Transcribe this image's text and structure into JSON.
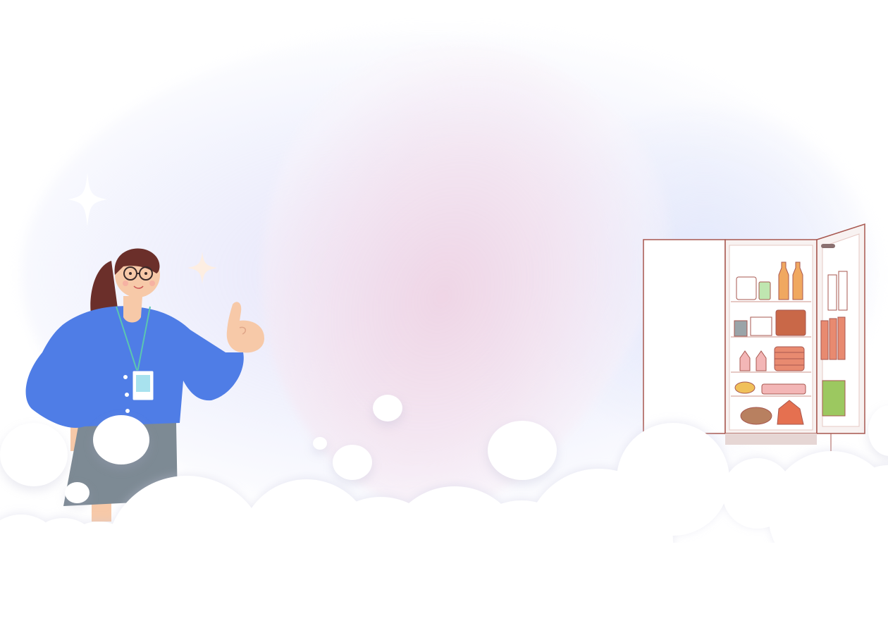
{
  "scene": {
    "illustration": "woman-thumbs-up-refrigerator",
    "background_color": "#ffffff",
    "colors": {
      "shirt": "#4f7de6",
      "skirt": "#7d8a94",
      "skin": "#f7c9a8",
      "hair": "#6b2f2a",
      "fridge_outline": "#a7574f",
      "lanyard": "#5bc6b0",
      "badge": "#a8e2ee"
    },
    "icons": [
      "sparkle-icon",
      "thumbs-up-icon",
      "id-badge-icon",
      "refrigerator-icon"
    ]
  }
}
